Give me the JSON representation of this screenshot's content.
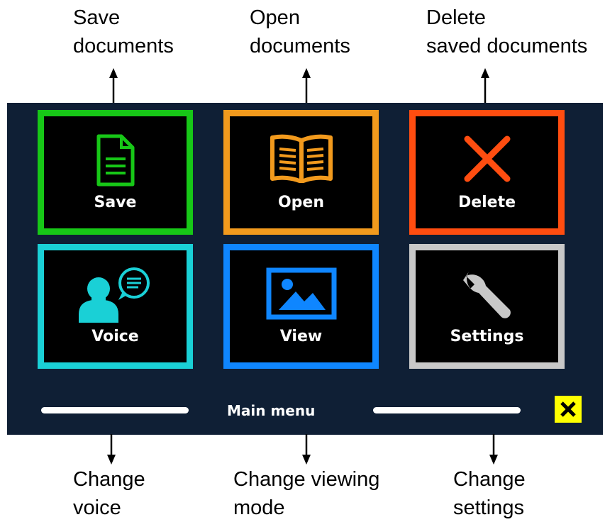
{
  "callouts": {
    "save": {
      "line1": "Save",
      "line2": "documents"
    },
    "open": {
      "line1": "Open",
      "line2": "documents"
    },
    "delete": {
      "line1": "Delete",
      "line2": "saved documents"
    },
    "voice": {
      "line1": "Change",
      "line2": "voice"
    },
    "view": {
      "line1": "Change viewing",
      "line2": "mode"
    },
    "settings": {
      "line1": "Change",
      "line2": "settings"
    }
  },
  "tiles": [
    {
      "label": "Save",
      "icon": "document-icon",
      "color": "#17c717"
    },
    {
      "label": "Open",
      "icon": "book-icon",
      "color": "#f29a1d"
    },
    {
      "label": "Delete",
      "icon": "x-icon",
      "color": "#ff4d10"
    },
    {
      "label": "Voice",
      "icon": "speaking-person-icon",
      "color": "#1ad0d6"
    },
    {
      "label": "View",
      "icon": "image-icon",
      "color": "#0f86ff"
    },
    {
      "label": "Settings",
      "icon": "wrench-icon",
      "color": "#c8c8c8"
    }
  ],
  "footer": {
    "title": "Main menu",
    "close_icon": "close-icon",
    "close_color": "#ffff00"
  },
  "colors": {
    "panel": "#0f1f35"
  }
}
